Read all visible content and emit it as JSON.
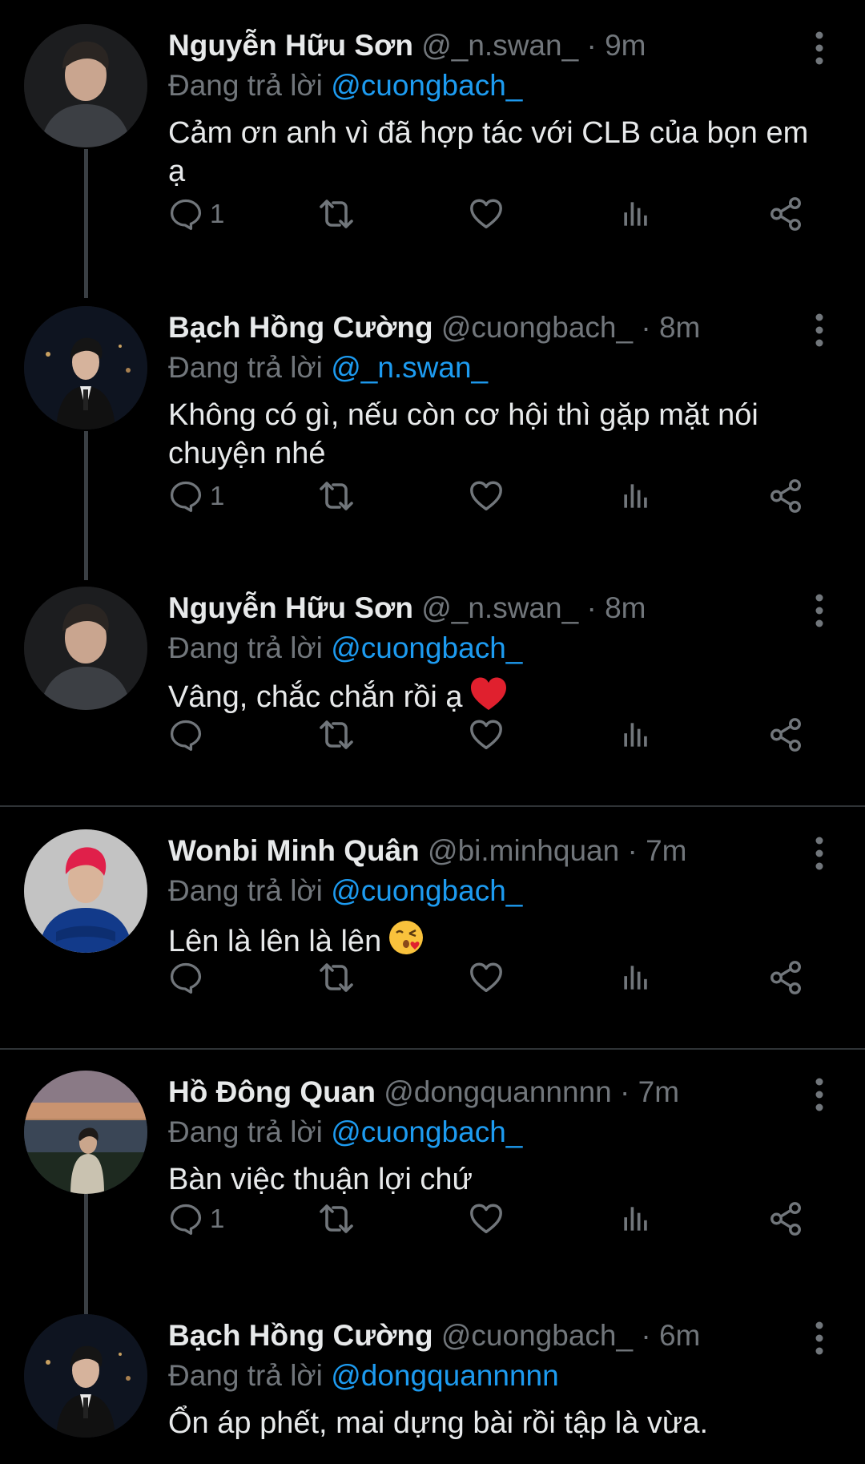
{
  "colors": {
    "background": "#000000",
    "text": "#e7e9ea",
    "muted": "#71767b",
    "mention": "#1d9bf0",
    "thread_line": "#3a3f44",
    "divider": "#2f3336"
  },
  "icons": {
    "reply": "reply-icon",
    "retweet": "retweet-icon",
    "like": "heart-icon",
    "views": "views-icon",
    "share": "share-icon",
    "more": "more-icon"
  },
  "reply_prefix": "Đang trả lời",
  "tweets": [
    {
      "name": "Nguyễn Hữu Sơn",
      "handle": "@_n.swan_",
      "separator": "·",
      "time": "9m",
      "reply_to": "@cuongbach_",
      "text": "Cảm ơn anh vì đã hợp tác với CLB của bọn em ạ",
      "reply_count": "1"
    },
    {
      "name": "Bạch Hồng Cường",
      "handle": "@cuongbach_",
      "separator": "·",
      "time": "8m",
      "reply_to": "@_n.swan_",
      "text": "Không có gì, nếu còn cơ hội thì gặp mặt nói chuyện nhé",
      "reply_count": "1"
    },
    {
      "name": "Nguyễn Hữu Sơn",
      "handle": "@_n.swan_",
      "separator": "·",
      "time": "8m",
      "reply_to": "@cuongbach_",
      "text": "Vâng, chắc chắn rồi ạ",
      "reply_count": ""
    },
    {
      "name": "Wonbi Minh Quân",
      "handle": "@bi.minhquan",
      "separator": "·",
      "time": "7m",
      "reply_to": "@cuongbach_",
      "text": "Lên là lên là lên",
      "reply_count": ""
    },
    {
      "name": "Hồ Đông Quan",
      "handle": "@dongquannnnn",
      "separator": "·",
      "time": "7m",
      "reply_to": "@cuongbach_",
      "text": "Bàn việc thuận lợi chứ",
      "reply_count": "1"
    },
    {
      "name": "Bạch Hồng Cường",
      "handle": "@cuongbach_",
      "separator": "·",
      "time": "6m",
      "reply_to": "@dongquannnnn",
      "text": "Ổn áp phết, mai dựng bài rồi tập là vừa.",
      "reply_count": ""
    }
  ]
}
